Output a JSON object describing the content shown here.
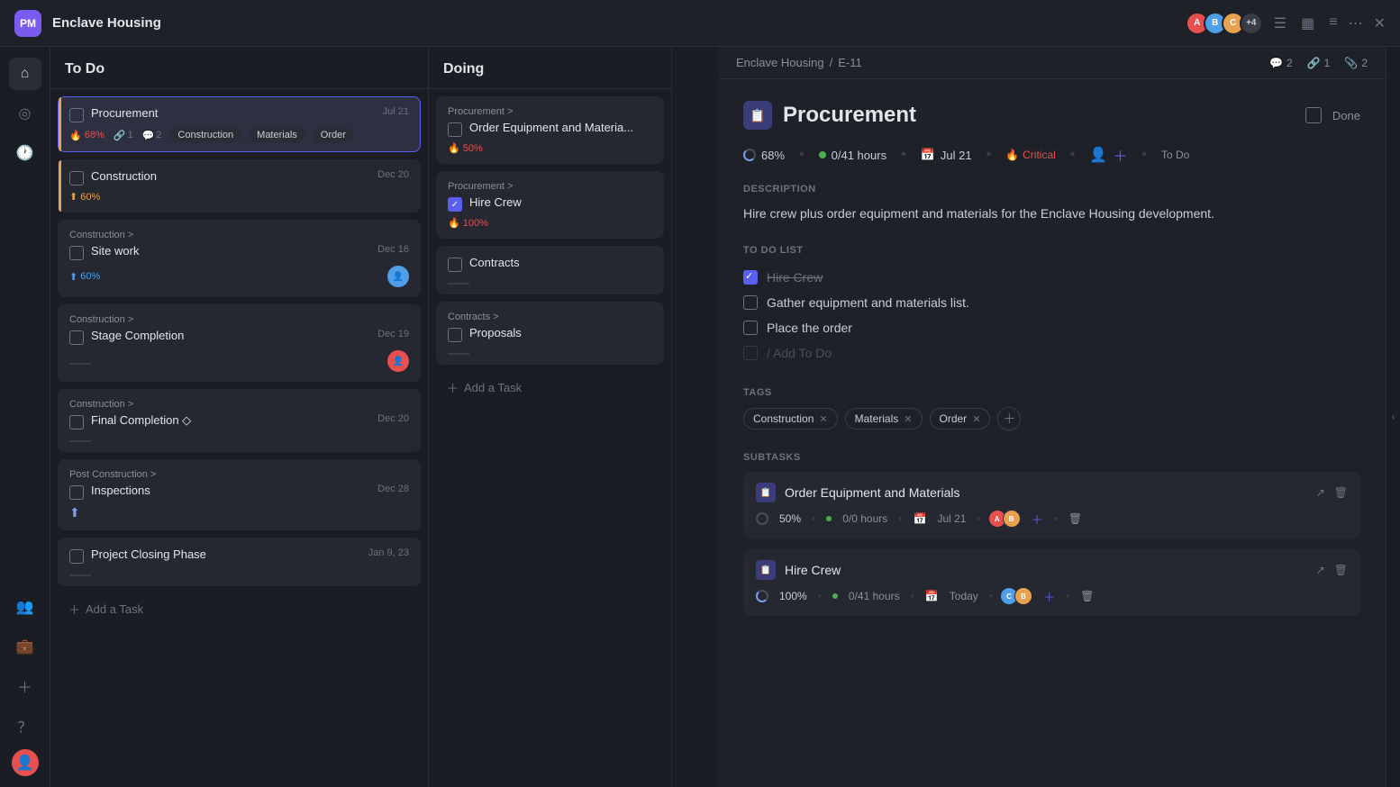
{
  "app": {
    "title": "Enclave Housing",
    "logo": "PM"
  },
  "topbar": {
    "title": "Enclave Housing",
    "avatars": [
      {
        "initials": "A",
        "color": "#e84f4f"
      },
      {
        "initials": "B",
        "color": "#4f9ee8"
      },
      {
        "initials": "C",
        "color": "#e8a14f"
      }
    ],
    "extra_count": "+4",
    "icons": [
      "≡",
      "▦",
      "☰"
    ]
  },
  "breadcrumb": {
    "project": "Enclave Housing",
    "separator": "/",
    "task_id": "E-11"
  },
  "detail_icons": {
    "comments": "2",
    "links": "1",
    "attachments": "2"
  },
  "todo_column": {
    "header": "To Do",
    "tasks": [
      {
        "id": "task-procurement",
        "title": "Procurement",
        "date": "Jul 21",
        "fire_pct": "68%",
        "links": "1",
        "comments": "2",
        "tags": [
          "Construction",
          "Materials",
          "Order"
        ],
        "active": true,
        "left_bar": "orange"
      },
      {
        "id": "task-construction",
        "title": "Construction",
        "date": "Dec 20",
        "percent": "60%",
        "percent_type": "yellow",
        "sub": "",
        "left_bar": "orange"
      },
      {
        "id": "task-site-work",
        "title": "Site work",
        "date": "Dec 16",
        "sub": "Construction >",
        "percent": "60%",
        "percent_type": "blue",
        "has_avatar": true
      },
      {
        "id": "task-stage-completion",
        "title": "Stage Completion",
        "date": "Dec 19",
        "sub": "Construction >",
        "has_avatar": true,
        "has_divider": true
      },
      {
        "id": "task-final-completion",
        "title": "Final Completion ◇",
        "date": "Dec 20",
        "sub": "Construction >",
        "has_divider": true
      },
      {
        "id": "task-inspections",
        "title": "Inspections",
        "date": "Dec 28",
        "sub": "Post Construction >",
        "has_progress": true
      },
      {
        "id": "task-project-closing",
        "title": "Project Closing Phase",
        "date": "Jan 9, 23",
        "has_divider": true
      }
    ],
    "add_label": "Add a Task"
  },
  "doing_column": {
    "header": "Doing",
    "tasks": [
      {
        "id": "doing-order",
        "sub": "Procurement >",
        "title": "Order Equipment and Materia...",
        "percent": "50%",
        "checked": false
      },
      {
        "id": "doing-hire",
        "sub": "Procurement >",
        "title": "Hire Crew",
        "percent": "100%",
        "checked": true
      },
      {
        "id": "doing-contracts",
        "title": "Contracts",
        "checked": false,
        "has_divider": true
      },
      {
        "id": "doing-proposals",
        "sub": "Contracts >",
        "title": "Proposals",
        "checked": false,
        "has_divider": true
      }
    ],
    "add_label": "Add a Task"
  },
  "detail": {
    "task_title": "Procurement",
    "done_label": "Done",
    "meta": {
      "progress_pct": "68%",
      "hours_green": "0/41 hours",
      "date": "Jul 21",
      "priority": "Critical",
      "status": "To Do"
    },
    "description_label": "DESCRIPTION",
    "description": "Hire crew plus order equipment and materials for the Enclave Housing development.",
    "todo_label": "TO DO LIST",
    "todo_items": [
      {
        "text": "Hire Crew",
        "done": true
      },
      {
        "text": "Gather equipment and materials list.",
        "done": false
      },
      {
        "text": "Place the order",
        "done": false
      }
    ],
    "todo_add_placeholder": "/ Add To Do",
    "tags_label": "TAGS",
    "tags": [
      "Construction",
      "Materials",
      "Order"
    ],
    "subtasks_label": "SUBTASKS",
    "subtasks": [
      {
        "id": "sub-order",
        "title": "Order Equipment and Materials",
        "percent": "50%",
        "hours": "0/0 hours",
        "date": "Jul 21",
        "avatars": [
          "#e84f4f",
          "#e8a14f"
        ]
      },
      {
        "id": "sub-hire",
        "title": "Hire Crew",
        "percent": "100%",
        "hours": "0/41 hours",
        "date": "Today",
        "avatars": [
          "#4f9ee8",
          "#e8a14f"
        ]
      }
    ]
  }
}
